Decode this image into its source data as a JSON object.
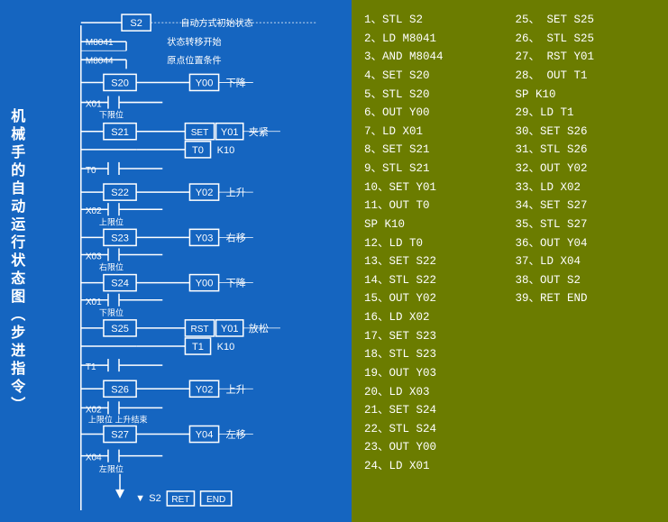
{
  "title": {
    "vertical": "机械手的自动运行状态图（步进指令）"
  },
  "codeLeft": [
    "1、STL S2",
    "2、LD  M8041",
    "3、AND M8044",
    "4、SET S20",
    "5、STL S20",
    "6、OUT Y00",
    "7、LD  X01",
    "8、SET S21",
    "9、STL S21",
    "10、SET Y01",
    "11、OUT T0",
    "    SP K10",
    "12、LD  T0",
    "13、SET S22",
    "14、STL S22",
    "15、OUT Y02",
    "16、LD  X02",
    "17、SET S23",
    "18、STL S23",
    "19、OUT Y03",
    "20、LD  X03",
    "21、SET S24",
    "22、STL S24",
    "23、OUT Y00",
    "24、LD  X01"
  ],
  "codeRight": [
    "25、 SET S25",
    "26、 STL S25",
    "27、 RST Y01",
    "28、 OUT T1",
    "     SP K10",
    "29、LD  T1",
    "30、SET S26",
    "31、STL S26",
    "32、OUT Y02",
    "33、LD  X02",
    "34、SET S27",
    "35、STL S27",
    "36、OUT Y04",
    "37、LD  X04",
    "38、OUT S2",
    "39、RET END"
  ],
  "ladder": {
    "nodes": []
  },
  "colors": {
    "blue": "#1565c0",
    "olive": "#6b7c00",
    "white": "#ffffff",
    "yellow": "#ffff00",
    "cyan": "#00ffff"
  }
}
